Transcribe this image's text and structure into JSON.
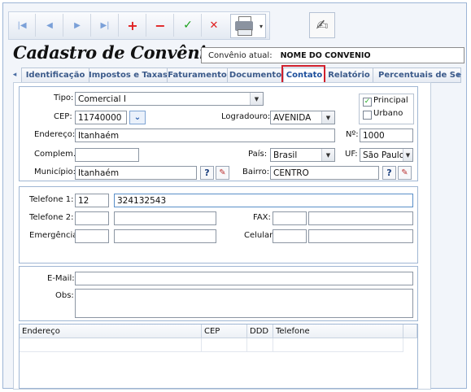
{
  "toolbar": {
    "buttons": [
      {
        "icon": "first-record-icon",
        "glyph": "|◀"
      },
      {
        "icon": "previous-record-icon",
        "glyph": "◀"
      },
      {
        "icon": "next-record-icon",
        "glyph": "▶"
      },
      {
        "icon": "last-record-icon",
        "glyph": "▶|"
      },
      {
        "icon": "add-icon",
        "glyph": "+"
      },
      {
        "icon": "remove-icon",
        "glyph": "−"
      },
      {
        "icon": "confirm-icon",
        "glyph": "✓"
      },
      {
        "icon": "cancel-icon",
        "glyph": "✕"
      }
    ],
    "print_arrow": "▾",
    "sign_glyph": "✍"
  },
  "header": {
    "title": "Cadastro de Convênios",
    "convenio_label": "Convênio atual:",
    "convenio_value": "NOME DO CONVENIO"
  },
  "tabs": [
    {
      "label": "Identificação"
    },
    {
      "label": "Impostos e Taxas"
    },
    {
      "label": "Faturamento"
    },
    {
      "label": "Documento"
    },
    {
      "label": "Contato",
      "active": true
    },
    {
      "label": "Relatório"
    },
    {
      "label": "Percentuais de Serv"
    }
  ],
  "tab_arrows": {
    "left": "◂",
    "right": "▸"
  },
  "address": {
    "tipo_label": "Tipo:",
    "tipo_value": "Comercial I",
    "principal_label": "Principal",
    "principal_checked": true,
    "urbano_label": "Urbano",
    "urbano_checked": false,
    "cep_label": "CEP:",
    "cep_value": "11740000",
    "logradouro_label": "Logradouro:",
    "logradouro_value": "AVENIDA",
    "endereco_label": "Endereço:",
    "endereco_value": "Itanhaém",
    "numero_label": "Nº:",
    "numero_value": "1000",
    "complemento_label": "Complem.:",
    "complemento_value": "",
    "pais_label": "País:",
    "pais_value": "Brasil",
    "uf_label": "UF:",
    "uf_value": "São Paulo",
    "municipio_label": "Município:",
    "municipio_value": "Itanhaém",
    "bairro_label": "Bairro:",
    "bairro_value": "CENTRO",
    "lookup_glyph": "?",
    "clear_glyph": "✎",
    "check_glyph": "✓",
    "chevron_glyph": "⌄",
    "dropdown_glyph": "▼"
  },
  "phones": {
    "telefone1_label": "Telefone 1:",
    "telefone1_ddd": "12",
    "telefone1_num": "324132543",
    "telefone2_label": "Telefone 2:",
    "telefone2_ddd": "",
    "telefone2_num": "",
    "fax_label": "FAX:",
    "fax_ddd": "",
    "fax_num": "",
    "emergencia_label": "Emergência:",
    "emergencia_ddd": "",
    "emergencia_num": "",
    "celular_label": "Celular:",
    "celular_ddd": "",
    "celular_num": ""
  },
  "contact": {
    "email_label": "E-Mail:",
    "email_value": "",
    "obs_label": "Obs:",
    "obs_value": ""
  },
  "grid": {
    "columns": [
      "Endereço",
      "CEP",
      "DDD",
      "Telefone"
    ]
  }
}
